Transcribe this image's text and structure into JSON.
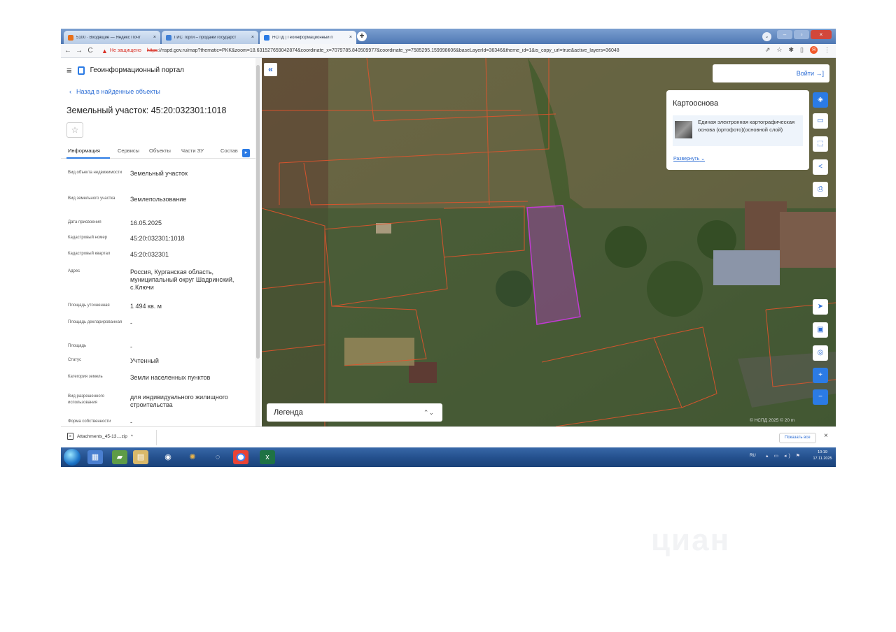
{
  "browser": {
    "tabs": [
      {
        "title": "5100 · Входящие — Яндекс Почт",
        "close": "×",
        "favicon_color": "#e8701a"
      },
      {
        "title": "ГИС Торги – продажи государст",
        "close": "×",
        "favicon_color": "#3e7fd6"
      },
      {
        "title": "НСПД | Геоинформационный п",
        "close": "×",
        "favicon_color": "#2b7be5"
      }
    ],
    "new_tab": "+",
    "back": "←",
    "forward": "→",
    "reload": "C",
    "not_secure": "Не защищено",
    "url_proto": "https",
    "url_rest": "://nspd.gov.ru/map?thematic=PKK&zoom=18.631527659042874&coordinate_x=7079785.840509977&coordinate_y=7585295.159998606&baseLayerId=36346&theme_id=1&is_copy_url=true&active_layers=36048"
  },
  "sidebar": {
    "portal_name": "Геоинформационный портал",
    "back_link": "Назад в найденные объекты",
    "title": "Земельный участок: 45:20:032301:1018",
    "star": "☆",
    "tabs": [
      "Информация",
      "Сервисы",
      "Объекты",
      "Части ЗУ",
      "Состав"
    ],
    "properties": [
      {
        "label": "Вид объекта недвижимости",
        "value": "Земельный участок"
      },
      {
        "label": "Вид земельного участка",
        "value": "Землепользование"
      },
      {
        "label": "Дата присвоения",
        "value": "16.05.2025"
      },
      {
        "label": "Кадастровый номер",
        "value": "45:20:032301:1018"
      },
      {
        "label": "Кадастровый квартал",
        "value": "45:20:032301"
      },
      {
        "label": "Адрес",
        "value": "Россия, Курганская область, муниципальный округ Шадринский, с.Ключи"
      },
      {
        "label": "Площадь уточненная",
        "value": "1 494 кв. м"
      },
      {
        "label": "Площадь декларированная",
        "value": "-"
      },
      {
        "label": "Площадь",
        "value": "-"
      },
      {
        "label": "Статус",
        "value": "Учтенный"
      },
      {
        "label": "Категория земель",
        "value": "Земли населенных пунктов"
      },
      {
        "label": "Вид разрешенного использования",
        "value": "для индивидуального жилищного строительства"
      },
      {
        "label": "Форма собственности",
        "value": "-"
      }
    ]
  },
  "map": {
    "collapse": "«",
    "login": "Войти",
    "login_icon": "→]",
    "layers_card": {
      "title": "Картооснова",
      "layer_name": "Единая электронная картографическая основа (ортофото)(основной слой)",
      "expand": "Развернуть"
    },
    "legend": "Легенда",
    "legend_arrow": "⌃⌄",
    "scale": "© НСПД 2025 ©      20 m",
    "selected_parcel_color": "#c23bd4",
    "boundary_color": "#e2542c"
  },
  "tools": [
    {
      "icon": "layers-icon",
      "glyph": "◈"
    },
    {
      "icon": "ruler-icon",
      "glyph": "▭"
    },
    {
      "icon": "select-area-icon",
      "glyph": "⬚"
    },
    {
      "icon": "share-icon",
      "glyph": "<"
    },
    {
      "icon": "print-icon",
      "glyph": "⎙"
    },
    {
      "icon": "locate-icon",
      "glyph": "➤"
    },
    {
      "icon": "screen-icon",
      "glyph": "▣"
    },
    {
      "icon": "target-icon",
      "glyph": "◎"
    },
    {
      "icon": "zoom-in-icon",
      "glyph": "+"
    },
    {
      "icon": "zoom-out-icon",
      "glyph": "−"
    }
  ],
  "downloads": {
    "file": "Attachments_45-13....zip",
    "caret": "^",
    "show_all": "Показать все",
    "close": "×"
  },
  "taskbar": {
    "lang": "RU",
    "time": "10:19",
    "date": "17.11.2025"
  }
}
